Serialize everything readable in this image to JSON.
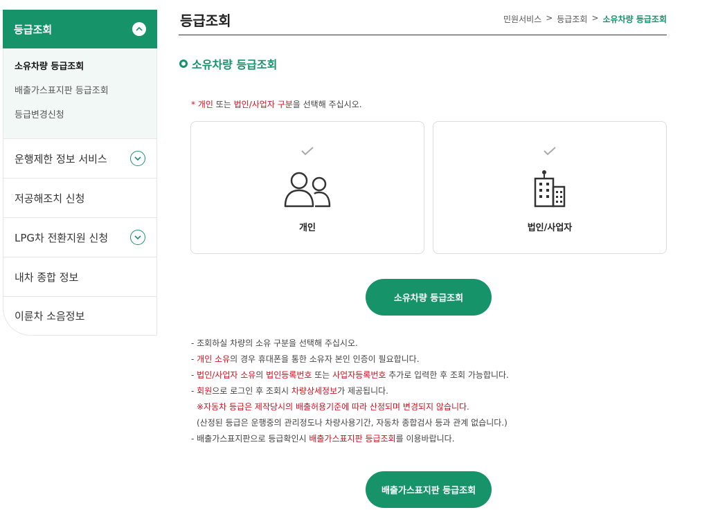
{
  "sidebar": {
    "header": "등급조회",
    "sub_items": [
      "소유차량 등급조회",
      "배출가스표지판 등급조회",
      "등급변경신청"
    ],
    "menu": [
      {
        "label": "운행제한 정보 서비스"
      },
      {
        "label": "저공해조치 신청"
      },
      {
        "label": "LPG차 전환지원 신청"
      },
      {
        "label": "내차 종합 정보"
      },
      {
        "label": "이륜차 소음정보"
      }
    ]
  },
  "header": {
    "title": "등급조회",
    "breadcrumb": [
      "민원서비스",
      "등급조회",
      "소유차량 등급조회"
    ],
    "separator": ">"
  },
  "section": {
    "title": "소유차량 등급조회"
  },
  "instruction": {
    "star": "* ",
    "part1": "개인",
    "part2": " 또는 ",
    "part3": "법인/사업자 구분",
    "part4": "을 선택해 주십시오."
  },
  "cards": [
    {
      "label": "개인",
      "icon": "people-icon",
      "check": "✓"
    },
    {
      "label": "법인/사업자",
      "icon": "building-icon",
      "check": "✓"
    }
  ],
  "buttons": {
    "search": "소유차량 등급조회",
    "plate": "배출가스표지판 등급조회"
  },
  "notes": {
    "line1": "- 조회하실 차량의 소유 구분을 선택해 주십시오.",
    "line2": {
      "dash": "- ",
      "red": "개인 소유",
      "rest": "의 경우 휴대폰을 통한 소유자 본인 인증이 필요합니다."
    },
    "line3": {
      "dash": "- ",
      "red1": "법인/사업자 소유",
      "mid1": "의 ",
      "red2": "법인등록번호",
      "mid2": " 또는 ",
      "red3": "사업자등록번호",
      "rest": " 추가로 입력한 후 조회 가능합니다."
    },
    "line4": {
      "dash": "- ",
      "red1": "회원",
      "mid": "으로 로그인 후 조회시 ",
      "red2": "차량상세정보",
      "rest": "가 제공됩니다."
    },
    "line5": "※자동차 등급은 제작당시의 배출허용기준에 따라 산정되며 변경되지 않습니다.",
    "line6": "(산정된 등급은 운행중의 관리정도나 차량사용기간, 자동차 종합검사 등과 관계 없습니다.)",
    "line7": {
      "pre": "- 배출가스표지판으로 등급확인시 ",
      "red": "배출가스표지판 등급조회",
      "rest": "를 이용바랍니다."
    }
  },
  "colors": {
    "accent": "#17936a",
    "highlight": "#d0101f"
  }
}
